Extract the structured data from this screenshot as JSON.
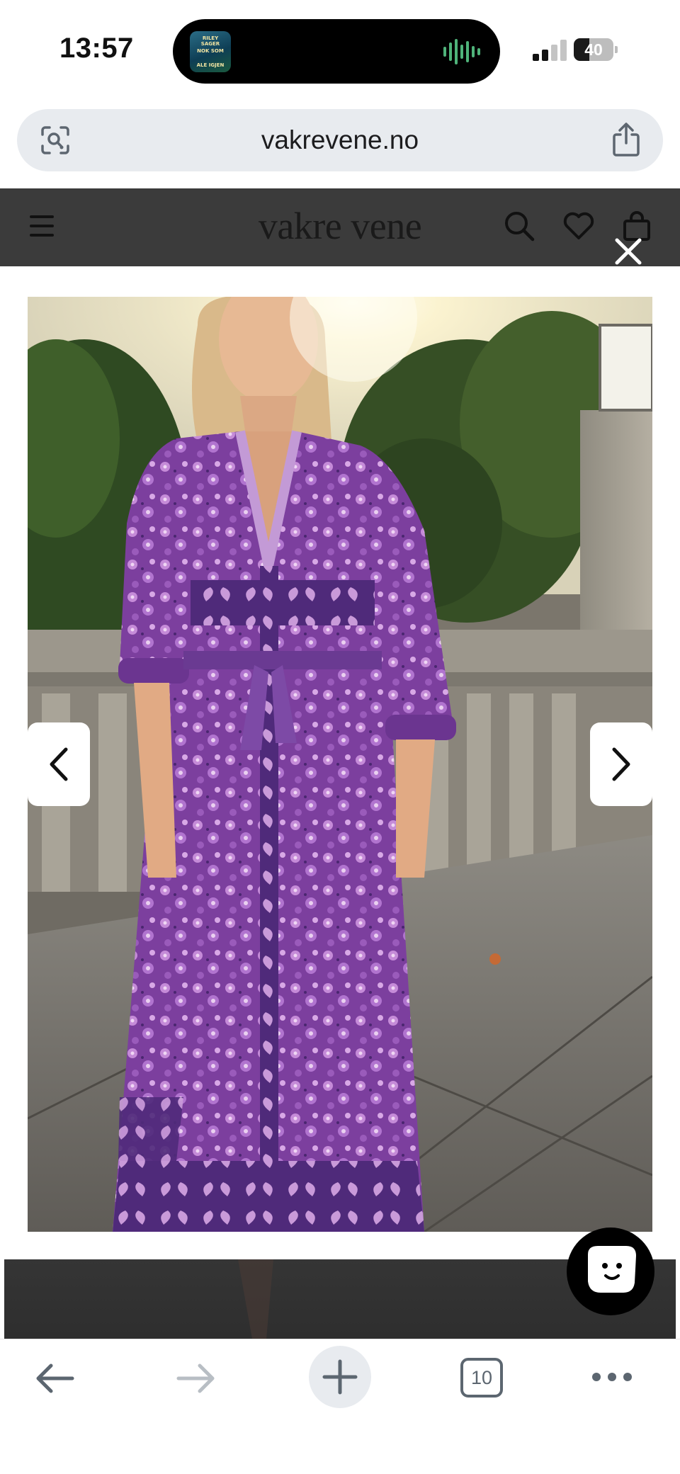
{
  "status_bar": {
    "time": "13:57",
    "battery_level": "40",
    "battery_fraction": 0.4,
    "now_playing_art_text": [
      "RILEY SAGER",
      "NOK SOM",
      "ALE IGJEN"
    ],
    "signal_bars_active": 2,
    "signal_bars_total": 4
  },
  "browser": {
    "url": "vakrevene.no",
    "url_left_icon": "visual-search-icon",
    "share_icon": "share-icon",
    "toolbar": {
      "back_icon": "back-arrow-icon",
      "forward_icon": "forward-arrow-icon",
      "new_tab_icon": "plus-icon",
      "tab_count": "10",
      "more_icon": "more-dots-icon"
    }
  },
  "site": {
    "logo": "vakre vene",
    "menu_icon": "hamburger-icon",
    "search_icon": "search-icon",
    "wishlist_icon": "heart-icon",
    "cart_icon": "shopping-bag-icon"
  },
  "lightbox": {
    "close_icon": "close-icon",
    "prev_icon": "chevron-left-icon",
    "next_icon": "chevron-right-icon",
    "image_subject": "product-photo-purple-floral-maxi-dress"
  },
  "chat": {
    "icon": "chat-face-icon"
  },
  "colors": {
    "header_bg": "#3b3b3b",
    "dress_purple": "#8a4fb0",
    "url_bar_bg": "#e8ebef",
    "chat_bg": "#000000"
  }
}
